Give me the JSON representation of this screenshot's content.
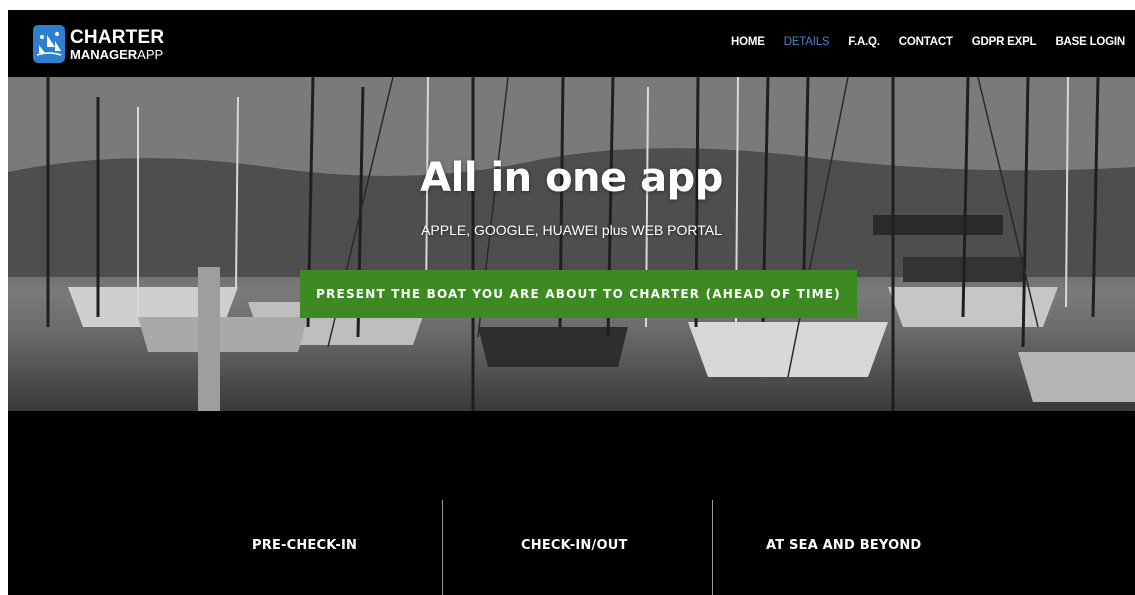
{
  "brand": {
    "line1": "CHARTER",
    "line2_bold": "MANAGER",
    "line2_regular": "APP",
    "logo_icon": "boats-logo-icon",
    "logo_color": "#2d7fd0"
  },
  "nav": {
    "items": [
      {
        "label": "HOME",
        "active": false
      },
      {
        "label": "DETAILS",
        "active": true
      },
      {
        "label": "F.A.Q.",
        "active": false
      },
      {
        "label": "CONTACT",
        "active": false
      },
      {
        "label": "GDPR EXPL",
        "active": false
      },
      {
        "label": "BASE LOGIN",
        "active": false
      }
    ],
    "active_color": "#4a86c8"
  },
  "hero": {
    "title": "All in one app",
    "subtitle": "APPLE, GOOGLE, HUAWEI plus WEB PORTAL",
    "cta_label": "PRESENT THE BOAT YOU ARE ABOUT TO CHARTER (AHEAD OF TIME)",
    "cta_color": "#3c8a21"
  },
  "features": {
    "columns": [
      {
        "label": "PRE-CHECK-IN"
      },
      {
        "label": "CHECK-IN/OUT"
      },
      {
        "label": "AT SEA AND BEYOND"
      }
    ]
  }
}
